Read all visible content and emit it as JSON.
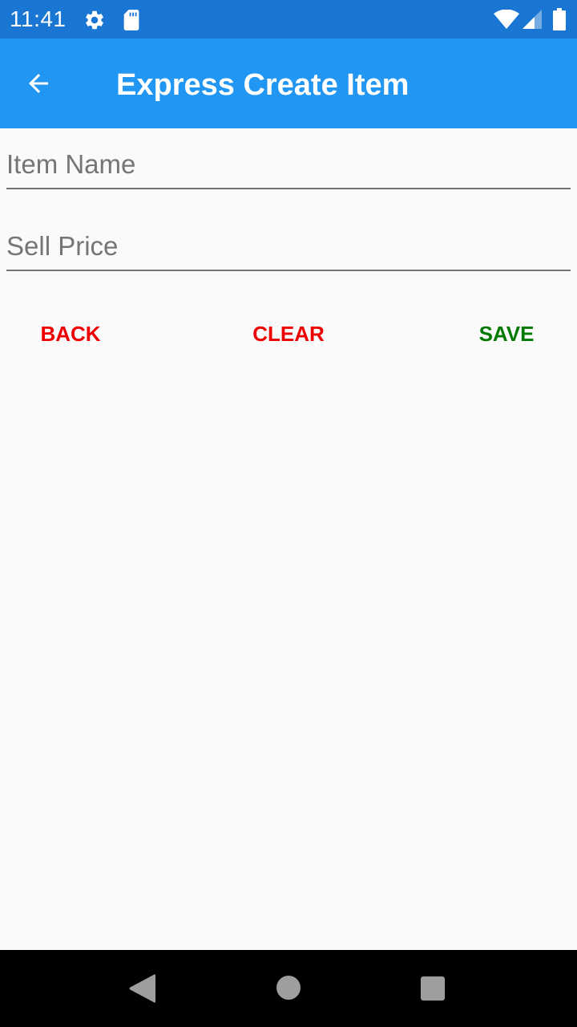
{
  "status_bar": {
    "time": "11:41",
    "icons": [
      "settings-gear-icon",
      "sd-card-icon",
      "wifi-icon",
      "signal-icon",
      "battery-icon"
    ]
  },
  "app_bar": {
    "title": "Express Create Item",
    "back_icon": "arrow-left-icon"
  },
  "form": {
    "item_name": {
      "value": "",
      "placeholder": "Item Name"
    },
    "sell_price": {
      "value": "",
      "placeholder": "Sell Price"
    }
  },
  "actions": {
    "back_label": "BACK",
    "clear_label": "CLEAR",
    "save_label": "SAVE"
  },
  "colors": {
    "status_bar": "#1976d2",
    "app_bar": "#2196f3",
    "back_clear_text": "#ee0000",
    "save_text": "#007a00",
    "background": "#fafafa"
  },
  "nav_bar": {
    "icons": [
      "nav-back-icon",
      "nav-home-icon",
      "nav-recents-icon"
    ]
  }
}
